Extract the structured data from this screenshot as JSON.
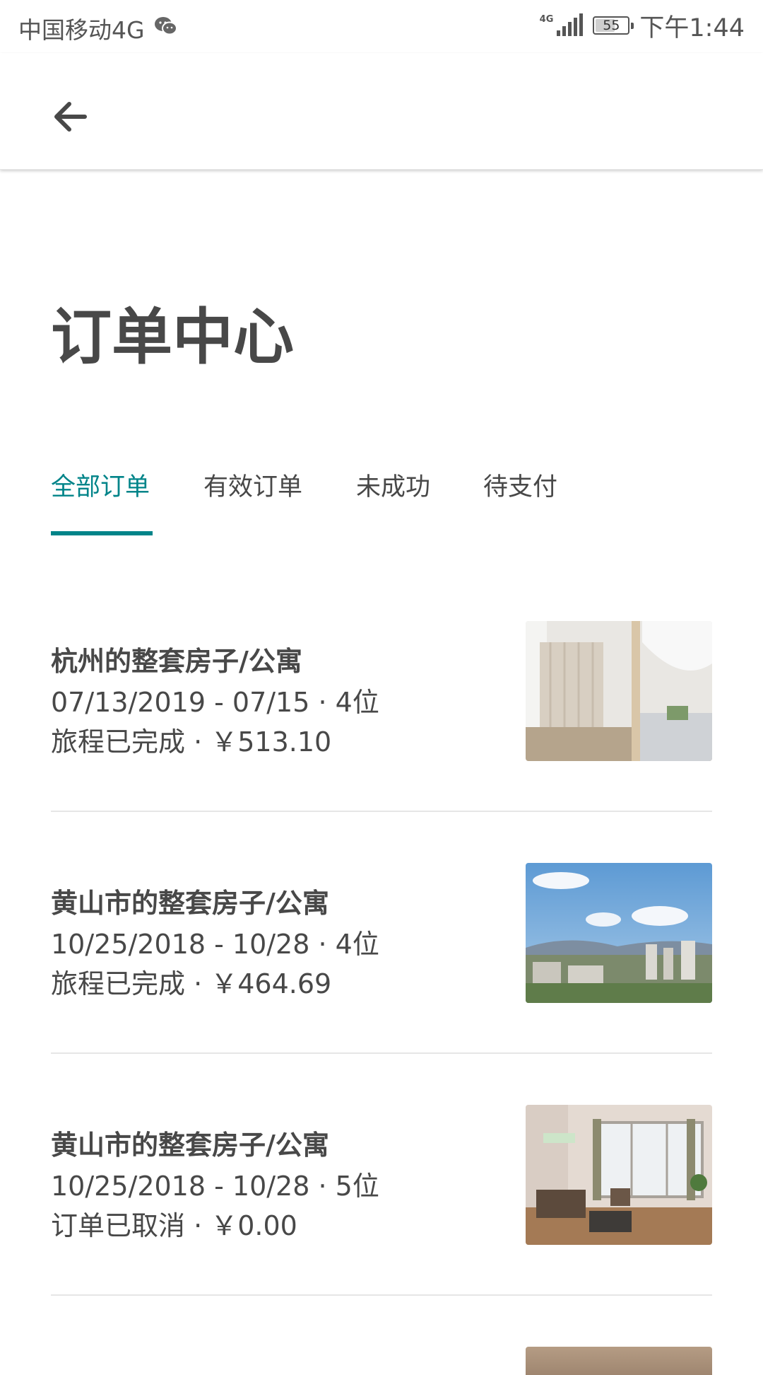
{
  "status_bar": {
    "carrier": "中国移动4G",
    "network": "4G",
    "battery": "55",
    "time": "下午1:44"
  },
  "nav": {
    "back_icon": "arrow-left-icon"
  },
  "page": {
    "title": "订单中心"
  },
  "tabs": [
    {
      "label": "全部订单",
      "active": true
    },
    {
      "label": "有效订单",
      "active": false
    },
    {
      "label": "未成功",
      "active": false
    },
    {
      "label": "待支付",
      "active": false
    }
  ],
  "orders": [
    {
      "title": "杭州的整套房子/公寓",
      "dates": "07/13/2019 - 07/15 · 4位",
      "status_price": "旅程已完成 · ￥513.10"
    },
    {
      "title": "黄山市的整套房子/公寓",
      "dates": "10/25/2018 - 10/28 · 4位",
      "status_price": "旅程已完成 · ￥464.69"
    },
    {
      "title": "黄山市的整套房子/公寓",
      "dates": "10/25/2018 - 10/28 · 5位",
      "status_price": "订单已取消 · ￥0.00"
    }
  ],
  "colors": {
    "accent": "#008489",
    "text": "#484848",
    "divider": "#e6e6e6"
  }
}
